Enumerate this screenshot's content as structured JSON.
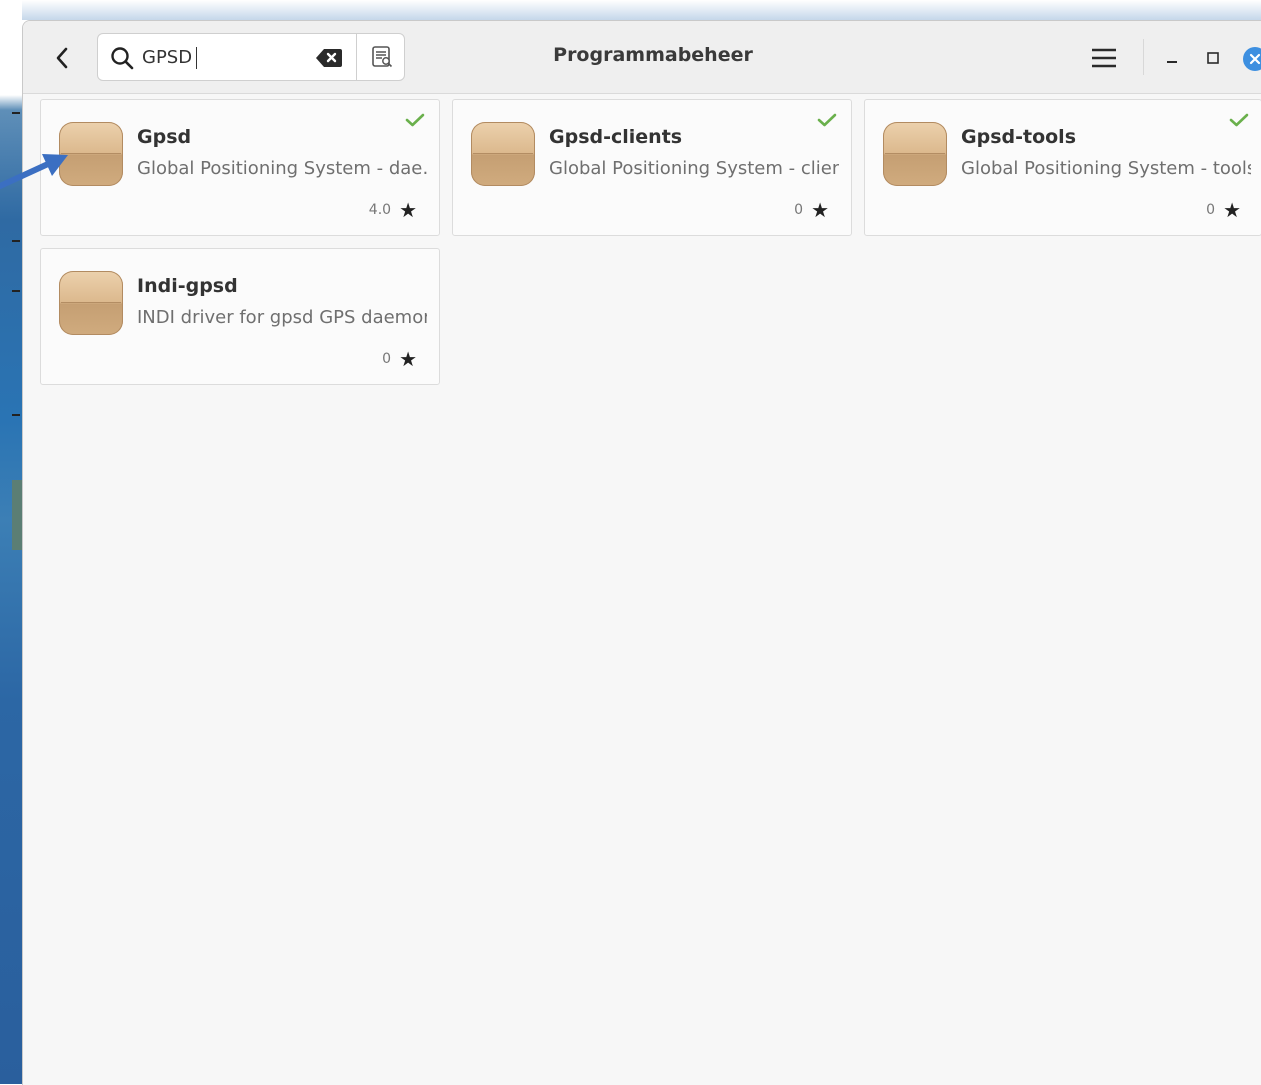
{
  "window": {
    "title": "Programmabeheer"
  },
  "search": {
    "value": "GPSD",
    "placeholder": ""
  },
  "results": [
    {
      "name": "Gpsd",
      "description": "Global Positioning System - dae…",
      "rating": "4.0",
      "installed": true
    },
    {
      "name": "Gpsd-clients",
      "description": "Global Positioning System - clients",
      "rating": "0",
      "installed": true
    },
    {
      "name": "Gpsd-tools",
      "description": "Global Positioning System - tools",
      "rating": "0",
      "installed": true
    },
    {
      "name": "Indi-gpsd",
      "description": "INDI driver for gpsd GPS daemon",
      "rating": "0",
      "installed": false
    }
  ],
  "icons": {
    "back": "chevron-left-icon",
    "search": "search-icon",
    "clear": "backspace-clear-icon",
    "filter": "search-filter-icon",
    "menu": "hamburger-menu-icon",
    "minimize": "minimize-icon",
    "maximize": "maximize-icon",
    "close": "close-icon",
    "installed": "checkmark-icon",
    "rating": "star-icon"
  },
  "colors": {
    "installed_check": "#6ab04c",
    "close_button": "#3d8fe0",
    "annotation_arrow": "#3b6fc2"
  }
}
